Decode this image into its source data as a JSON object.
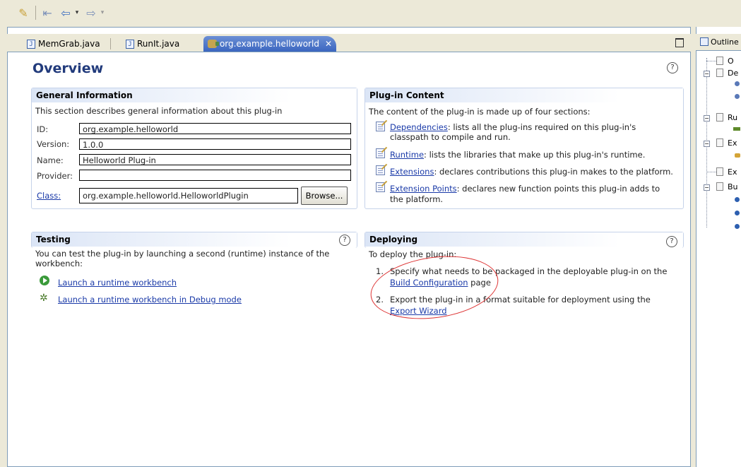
{
  "tabs": [
    {
      "label": "MemGrab.java"
    },
    {
      "label": "RunIt.java"
    },
    {
      "label": "org.example.helloworld",
      "close": "✕"
    }
  ],
  "page": {
    "title": "Overview",
    "help": "?"
  },
  "general": {
    "title": "General Information",
    "description": "This section describes general information about this plug-in",
    "id_label": "ID:",
    "id_value": "org.example.helloworld",
    "version_label": "Version:",
    "version_value": "1.0.0",
    "name_label": "Name:",
    "name_value": "Helloworld Plug-in",
    "provider_label": "Provider:",
    "provider_value": "",
    "class_label": "Class:",
    "class_value": "org.example.helloworld.HelloworldPlugin",
    "browse_label": "Browse..."
  },
  "content": {
    "title": "Plug-in Content",
    "intro": "The content of the plug-in is made up of four sections:",
    "items": [
      {
        "link": "Dependencies",
        "text_1": ": lists all the plug-ins required on this plug-in's",
        "text_2": "classpath to compile and run."
      },
      {
        "link": "Runtime",
        "text_1": ": lists the libraries that make up this plug-in's runtime."
      },
      {
        "link": "Extensions",
        "text_1": ": declares contributions this plug-in makes to the platform."
      },
      {
        "link": "Extension Points",
        "text_1": ": declares new function points this plug-in adds to",
        "text_2": "the platform."
      }
    ]
  },
  "testing": {
    "title": "Testing",
    "help": "?",
    "line_1": "You can test the plug-in by launching a second (runtime) instance of the",
    "line_2": "workbench:",
    "launch": "Launch a runtime workbench",
    "launch_debug": "Launch a runtime workbench in Debug mode"
  },
  "deploying": {
    "title": "Deploying",
    "help": "?",
    "intro": "To deploy the plug-in:",
    "step1_num": "1.",
    "step1_text": "Specify what needs to be packaged in the deployable plug-in on the",
    "step1_link": "Build Configuration",
    "step1_tail": " page",
    "step2_num": "2.",
    "step2_text": "Export the plug-in in a format suitable for deployment using the",
    "step2_link": "Export Wizard"
  },
  "outline": {
    "title": "Outline",
    "items": [
      "O",
      "De",
      "Ru",
      "Ex",
      "Ex",
      "Bu"
    ]
  },
  "colors": {
    "title_blue": "#223b7c",
    "link_blue": "#1a3aa8",
    "annotation_red": "#dd3333"
  }
}
